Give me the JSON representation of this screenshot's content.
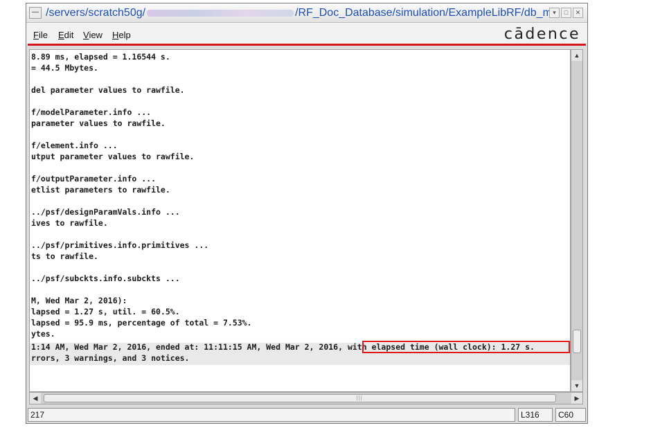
{
  "window": {
    "title_prefix": "/servers/scratch50g/",
    "title_suffix": "/RF_Doc_Database/simulation/ExampleLibRF/db_mi"
  },
  "menubar": {
    "items": [
      {
        "key": "F",
        "rest": "ile"
      },
      {
        "key": "E",
        "rest": "dit"
      },
      {
        "key": "V",
        "rest": "iew"
      },
      {
        "key": "H",
        "rest": "elp"
      }
    ],
    "logo": "cādence"
  },
  "log_lines": [
    "8.89 ms, elapsed = 1.16544 s.",
    "= 44.5 Mbytes.",
    "",
    "del parameter values to rawfile.",
    "",
    "f/modelParameter.info ...",
    "parameter values to rawfile.",
    "",
    "f/element.info ...",
    "utput parameter values to rawfile.",
    "",
    "f/outputParameter.info ...",
    "etlist parameters to rawfile.",
    "",
    "../psf/designParamVals.info ...",
    "ives to rawfile.",
    "",
    "../psf/primitives.info.primitives ...",
    "ts to rawfile.",
    "",
    "../psf/subckts.info.subckts ...",
    "",
    "M, Wed Mar 2, 2016):",
    "lapsed = 1.27 s, util. = 60.5%.",
    "lapsed = 95.9 ms, percentage of total = 7.53%.",
    "ytes.",
    "1:14 AM, Wed Mar 2, 2016, ended at: 11:11:15 AM, Wed Mar 2, 2016, with elapsed time (wall clock): 1.27 s.",
    "rrors, 3 warnings, and 3 notices."
  ],
  "status": {
    "left": "217",
    "line": "L316",
    "column": "C60"
  },
  "colors": {
    "accent_red": "#d6161c",
    "title_blue": "#1c4fb0"
  }
}
